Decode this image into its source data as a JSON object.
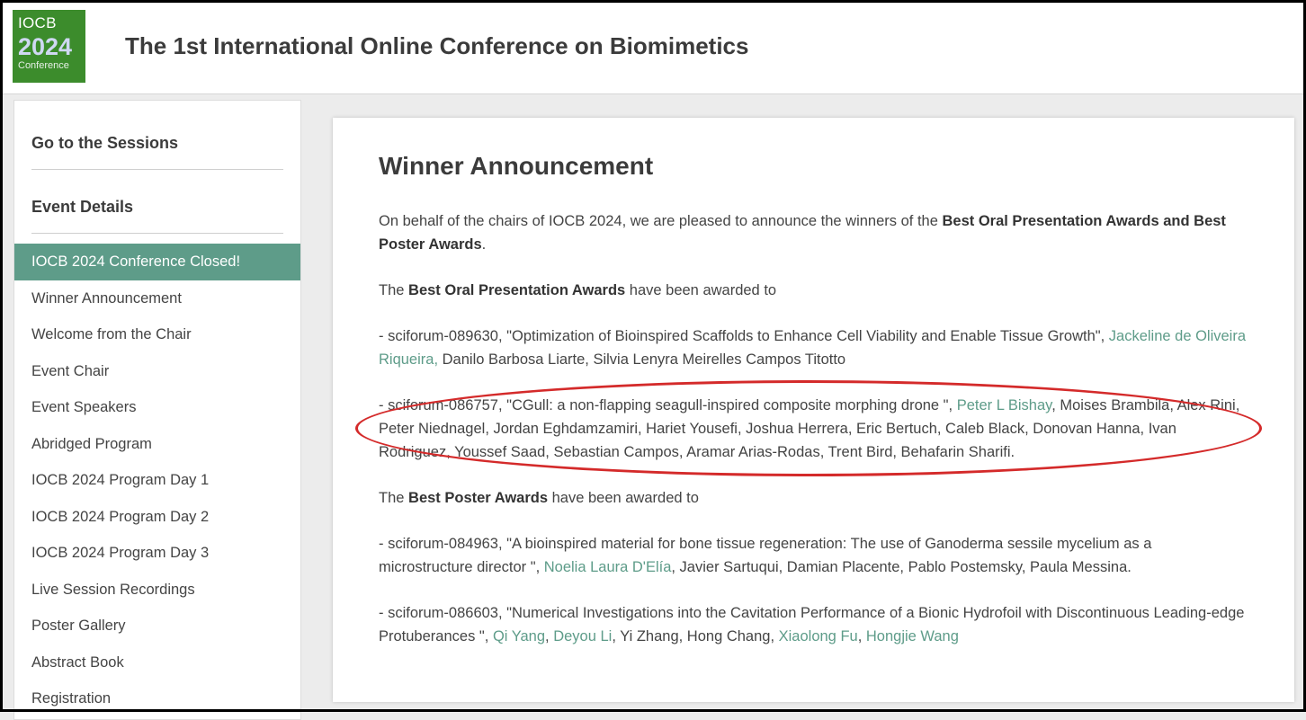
{
  "header": {
    "logo": {
      "line1": "IOCB",
      "line2": "2024",
      "line3": "Conference"
    },
    "title": "The 1st International Online Conference on Biomimetics"
  },
  "sidebar": {
    "sessions_heading": "Go to the Sessions",
    "details_heading": "Event Details",
    "items": [
      {
        "label": "IOCB 2024 Conference Closed!",
        "active": true
      },
      {
        "label": "Winner Announcement"
      },
      {
        "label": "Welcome from the Chair"
      },
      {
        "label": "Event Chair"
      },
      {
        "label": "Event Speakers"
      },
      {
        "label": "Abridged Program"
      },
      {
        "label": "IOCB 2024 Program Day 1"
      },
      {
        "label": "IOCB 2024 Program Day 2"
      },
      {
        "label": "IOCB 2024 Program Day 3"
      },
      {
        "label": "Live Session Recordings"
      },
      {
        "label": "Poster Gallery"
      },
      {
        "label": "Abstract Book"
      },
      {
        "label": "Registration"
      }
    ]
  },
  "main": {
    "heading": "Winner Announcement",
    "intro": {
      "pre": "On behalf of the chairs of IOCB 2024, we are pleased to announce the winners of the ",
      "bold": "Best Oral Presentation Awards and Best Poster Awards",
      "post": "."
    },
    "oral_intro": {
      "pre": "The ",
      "bold": "Best Oral Presentation Awards",
      "post": " have been awarded to"
    },
    "oral_entries": [
      {
        "prefix": "- sciforum-089630, \"Optimization of Bioinspired Scaffolds to Enhance Cell Viability and Enable Tissue Growth\", ",
        "link1": "Jackeline de Oliveira Riqueira,",
        "rest": " Danilo Barbosa Liarte, Silvia Lenyra Meirelles Campos Titotto"
      },
      {
        "prefix": "- sciforum-086757, \"CGull: a non-flapping seagull-inspired composite morphing drone \", ",
        "link1": "Peter L Bishay",
        "rest": ", Moises Brambila, Alex Rini, Peter Niednagel, Jordan Eghdamzamiri, Hariet Yousefi, Joshua Herrera, Eric Bertuch, Caleb Black, Donovan Hanna, Ivan Rodriguez, Youssef Saad, Sebastian Campos, Aramar Arias-Rodas, Trent Bird, Behafarin Sharifi."
      }
    ],
    "poster_intro": {
      "pre": "The ",
      "bold": "Best Poster Awards",
      "post": " have been awarded to"
    },
    "poster_entries": [
      {
        "prefix": "- sciforum-084963, \"A bioinspired material for bone tissue regeneration: The use of Ganoderma sessile mycelium as a microstructure director \", ",
        "link1": "Noelia Laura D'Elía",
        "rest": ", Javier Sartuqui, Damian Placente, Pablo Postemsky, Paula Messina."
      },
      {
        "prefix": "- sciforum-086603, \"Numerical Investigations into the Cavitation Performance of a Bionic Hydrofoil with Discontinuous Leading-edge Protuberances \", ",
        "link1": "Qi Yang",
        "sep1": ", ",
        "link2": "Deyou Li",
        "mid": ", Yi Zhang, Hong Chang, ",
        "link3": "Xiaolong Fu",
        "sep2": ", ",
        "link4": "Hongjie Wang"
      }
    ]
  },
  "colors": {
    "accent": "#5e9c89",
    "logo_green": "#3c8c2c",
    "highlight": "#d42a2a"
  }
}
